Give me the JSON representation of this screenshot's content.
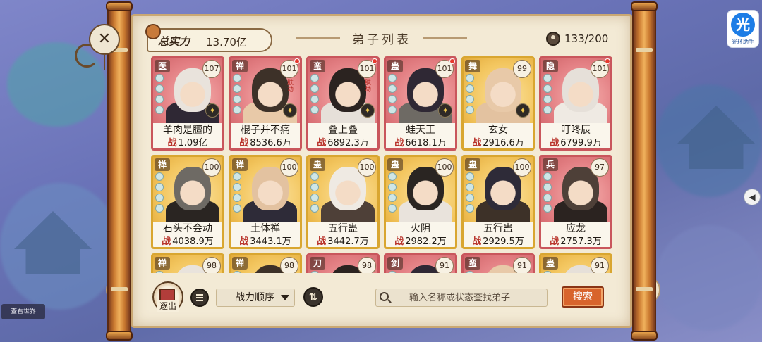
{
  "header": {
    "strength_label": "总实力",
    "strength_value": "13.70亿",
    "title": "弟子列表",
    "count": "133/200"
  },
  "cards": [
    {
      "faction": "医",
      "level": "107",
      "name": "羊肉是膻的",
      "power": "1.09亿",
      "style": "red",
      "dot": false,
      "star": true,
      "stamp": ""
    },
    {
      "faction": "禅",
      "level": "101",
      "name": "棍子并不痛",
      "power": "8536.6万",
      "style": "red",
      "dot": true,
      "star": true,
      "stamp": "肤劫"
    },
    {
      "faction": "蛮",
      "level": "101",
      "name": "叠上叠",
      "power": "6892.3万",
      "style": "red",
      "dot": true,
      "star": true,
      "stamp": "肤劫"
    },
    {
      "faction": "蛊",
      "level": "101",
      "name": "蛙天王",
      "power": "6618.1万",
      "style": "red",
      "dot": true,
      "star": true,
      "stamp": ""
    },
    {
      "faction": "舞",
      "level": "99",
      "name": "玄女",
      "power": "2916.6万",
      "style": "gold",
      "dot": false,
      "star": true,
      "stamp": ""
    },
    {
      "faction": "隐",
      "level": "101",
      "name": "叮咚辰",
      "power": "6799.9万",
      "style": "red",
      "dot": true,
      "star": false,
      "stamp": ""
    },
    {
      "faction": "禅",
      "level": "100",
      "name": "石头不会动",
      "power": "4038.9万",
      "style": "gold",
      "dot": false,
      "star": false,
      "stamp": ""
    },
    {
      "faction": "禅",
      "level": "100",
      "name": "土体禅",
      "power": "3443.1万",
      "style": "gold",
      "dot": false,
      "star": false,
      "stamp": ""
    },
    {
      "faction": "蛊",
      "level": "100",
      "name": "五行蛊",
      "power": "3442.7万",
      "style": "gold",
      "dot": false,
      "star": false,
      "stamp": ""
    },
    {
      "faction": "蛊",
      "level": "100",
      "name": "火阴",
      "power": "2982.2万",
      "style": "gold",
      "dot": false,
      "star": false,
      "stamp": ""
    },
    {
      "faction": "蛊",
      "level": "100",
      "name": "五行蛊",
      "power": "2929.5万",
      "style": "gold",
      "dot": false,
      "star": false,
      "stamp": ""
    },
    {
      "faction": "兵",
      "level": "97",
      "name": "应龙",
      "power": "2757.3万",
      "style": "red",
      "dot": false,
      "star": false,
      "stamp": ""
    },
    {
      "faction": "禅",
      "level": "98",
      "name": "",
      "power": "",
      "style": "gold",
      "dot": false,
      "star": false,
      "stamp": ""
    },
    {
      "faction": "禅",
      "level": "98",
      "name": "",
      "power": "",
      "style": "gold",
      "dot": false,
      "star": false,
      "stamp": ""
    },
    {
      "faction": "刀",
      "level": "98",
      "name": "",
      "power": "",
      "style": "red",
      "dot": false,
      "star": false,
      "stamp": ""
    },
    {
      "faction": "剑",
      "level": "91",
      "name": "",
      "power": "",
      "style": "red",
      "dot": false,
      "star": false,
      "stamp": ""
    },
    {
      "faction": "蛮",
      "level": "91",
      "name": "",
      "power": "",
      "style": "red",
      "dot": false,
      "star": false,
      "stamp": ""
    },
    {
      "faction": "蛊",
      "level": "91",
      "name": "",
      "power": "",
      "style": "gold",
      "dot": false,
      "star": false,
      "stamp": ""
    }
  ],
  "power_prefix": "战",
  "toolbar": {
    "recruit_label": "逐出",
    "sort_label": "战力顺序",
    "search_placeholder": "输入名称或状态查找弟子",
    "search_button": "搜索"
  },
  "overlay": {
    "helper_glyph": "光",
    "helper_label": "光环助手",
    "corner_chip": "查看世界"
  },
  "colors": {
    "accent": "#d8642c",
    "card_red": "#e97a7e",
    "card_gold": "#f2c55c",
    "paper": "#f3ead5",
    "level_dot": "#e63a2e"
  },
  "icons": {
    "count": "person-icon",
    "sort_toggle": "swap-arrows-icon",
    "search": "search-icon",
    "list": "list-icon",
    "close": "close-icon"
  }
}
